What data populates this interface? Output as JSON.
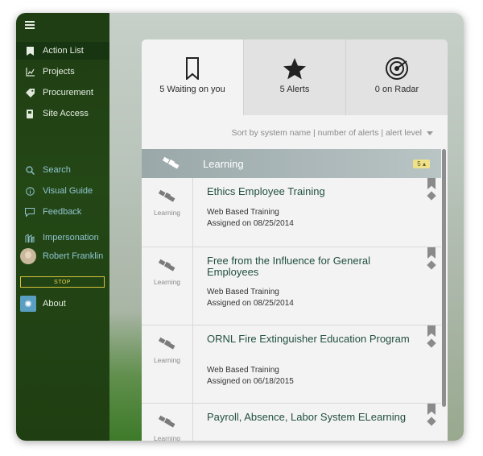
{
  "sidebar": {
    "nav": [
      {
        "label": "Action List",
        "icon": "bookmark-icon"
      },
      {
        "label": "Projects",
        "icon": "chart-icon"
      },
      {
        "label": "Procurement",
        "icon": "tag-icon"
      },
      {
        "label": "Site Access",
        "icon": "badge-icon"
      }
    ],
    "secondary": [
      {
        "label": "Search",
        "icon": "search-icon"
      },
      {
        "label": "Visual Guide",
        "icon": "info-icon"
      },
      {
        "label": "Feedback",
        "icon": "feedback-icon"
      }
    ],
    "impersonation": "Impersonation",
    "user_name": "Robert Franklin",
    "stop_label": "STOP",
    "about_label": "About"
  },
  "tabs": [
    {
      "label": "5 Waiting on you",
      "icon": "bookmark-icon"
    },
    {
      "label": "5 Alerts",
      "icon": "star-icon"
    },
    {
      "label": "0 on Radar",
      "icon": "radar-icon"
    }
  ],
  "sort_text": "Sort by system name | number of alerts | alert level",
  "group": {
    "label": "Learning",
    "count": "5"
  },
  "items": [
    {
      "category": "Learning",
      "title": "Ethics Employee Training",
      "type": "Web Based Training",
      "assigned": "Assigned on 08/25/2014"
    },
    {
      "category": "Learning",
      "title": "Free from the Influence for General Employees",
      "type": "Web Based Training",
      "assigned": "Assigned on 08/25/2014"
    },
    {
      "category": "Learning",
      "title": "ORNL Fire Extinguisher Education Program",
      "type": "Web Based Training",
      "assigned": "Assigned on 06/18/2015"
    },
    {
      "category": "Learning",
      "title": "Payroll, Absence, Labor System ELearning",
      "type": "",
      "assigned": ""
    }
  ]
}
